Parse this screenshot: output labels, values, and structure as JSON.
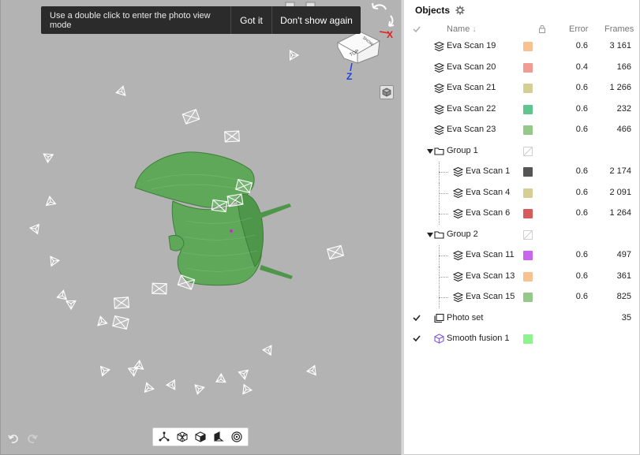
{
  "viewport": {
    "toast": {
      "message": "Use a double click to enter the photo view mode",
      "got_it": "Got it",
      "dont_show": "Don't show again"
    },
    "view_cube": {
      "face_top": "TOP",
      "face_side": "SHOW",
      "axis_x": "X",
      "axis_z": "Z"
    },
    "model_color": "#5fa85a",
    "bottom_tools": [
      "pivot-icon",
      "mesh-view-icon",
      "solid-view-icon",
      "textured-view-icon",
      "target-icon"
    ]
  },
  "panel": {
    "title": "Objects",
    "columns": {
      "name": "Name",
      "error": "Error",
      "frames": "Frames"
    },
    "rows": [
      {
        "name": "Eva Scan 19",
        "color": "#f7c28f",
        "error": "0.6",
        "frames": "3 161",
        "level": 0,
        "icon": "scan-icon",
        "checked": false
      },
      {
        "name": "Eva Scan 20",
        "color": "#f29a94",
        "error": "0.4",
        "frames": "166",
        "level": 0,
        "icon": "scan-icon",
        "checked": false
      },
      {
        "name": "Eva Scan 21",
        "color": "#d6cf95",
        "error": "0.6",
        "frames": "1 266",
        "level": 0,
        "icon": "scan-icon",
        "checked": false
      },
      {
        "name": "Eva Scan 22",
        "color": "#5fc78e",
        "error": "0.6",
        "frames": "232",
        "level": 0,
        "icon": "scan-icon",
        "checked": false
      },
      {
        "name": "Eva Scan 23",
        "color": "#94c98a",
        "error": "0.6",
        "frames": "466",
        "level": 0,
        "icon": "scan-icon",
        "checked": false
      },
      {
        "name": "Group 1",
        "color": "",
        "error": "",
        "frames": "",
        "level": 0,
        "icon": "folder-icon",
        "group": true,
        "checked": false
      },
      {
        "name": "Eva Scan 1",
        "color": "#555555",
        "error": "0.6",
        "frames": "2 174",
        "level": 1,
        "icon": "scan-icon",
        "checked": false
      },
      {
        "name": "Eva Scan 4",
        "color": "#d6cf95",
        "error": "0.6",
        "frames": "2 091",
        "level": 1,
        "icon": "scan-icon",
        "checked": false
      },
      {
        "name": "Eva Scan 6",
        "color": "#d65c5c",
        "error": "0.6",
        "frames": "1 264",
        "level": 1,
        "icon": "scan-icon",
        "checked": false
      },
      {
        "name": "Group 2",
        "color": "",
        "error": "",
        "frames": "",
        "level": 0,
        "icon": "folder-icon",
        "group": true,
        "checked": false
      },
      {
        "name": "Eva Scan 11",
        "color": "#c966ee",
        "error": "0.6",
        "frames": "497",
        "level": 1,
        "icon": "scan-icon",
        "checked": false
      },
      {
        "name": "Eva Scan 13",
        "color": "#f7c28f",
        "error": "0.6",
        "frames": "361",
        "level": 1,
        "icon": "scan-icon",
        "checked": false
      },
      {
        "name": "Eva Scan 15",
        "color": "#94c98a",
        "error": "0.6",
        "frames": "825",
        "level": 1,
        "icon": "scan-icon",
        "checked": false
      },
      {
        "name": "Photo set",
        "color": "",
        "error": "",
        "frames": "35",
        "level": 0,
        "icon": "photo-set-icon",
        "checked": true
      },
      {
        "name": "Smooth fusion 1",
        "color": "#8ef28e",
        "error": "",
        "frames": "",
        "level": 0,
        "icon": "fusion-icon",
        "checked": true
      }
    ]
  }
}
